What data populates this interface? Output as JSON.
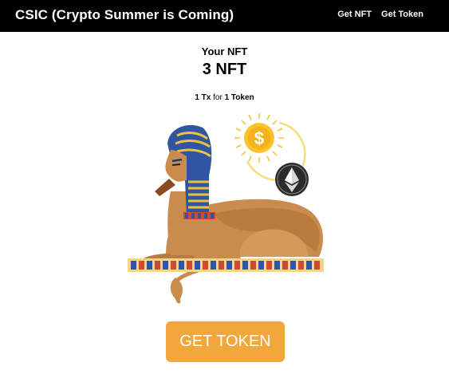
{
  "navbar": {
    "brand": "CSIC (Crypto Summer is Coming)",
    "links": [
      "Get NFT",
      "Get Token"
    ]
  },
  "summary": {
    "label": "Your NFT",
    "count": "3 NFT",
    "rate": {
      "tx_amount": "1 Tx",
      "connector": "for",
      "token_amount": "1 Token"
    }
  },
  "illustration": {
    "coin_symbol": "$"
  },
  "cta": {
    "label": "GET TOKEN",
    "color": "#f1a73b"
  }
}
